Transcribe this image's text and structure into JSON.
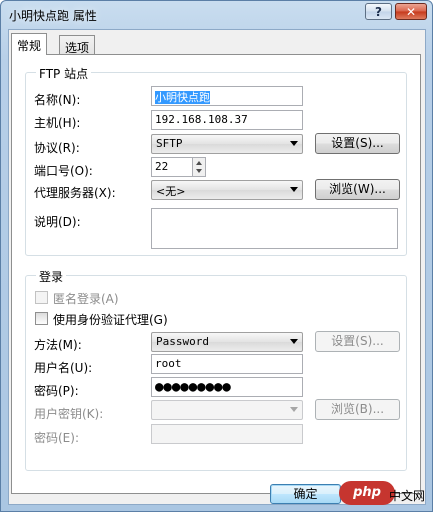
{
  "window": {
    "title": "小明快点跑 属性",
    "help_label": "?",
    "close_label": "✕"
  },
  "tabs": [
    {
      "label": "常规",
      "active": true
    },
    {
      "label": "选项",
      "active": false
    }
  ],
  "ftp_group": {
    "title": "FTP 站点",
    "name_label": "名称(N):",
    "name_value": "小明快点跑",
    "host_label": "主机(H):",
    "host_value": "192.168.108.37",
    "protocol_label": "协议(R):",
    "protocol_value": "SFTP",
    "settings_button": "设置(S)...",
    "port_label": "端口号(O):",
    "port_value": "22",
    "proxy_label": "代理服务器(X):",
    "proxy_value": "<无>",
    "browse_button": "浏览(W)...",
    "desc_label": "说明(D):"
  },
  "login_group": {
    "title": "登录",
    "anonymous_label": "匿名登录(A)",
    "use_proxy_auth_label": "使用身份验证代理(G)",
    "method_label": "方法(M):",
    "method_value": "Password",
    "settings_button": "设置(S)...",
    "username_label": "用户名(U):",
    "username_value": "root",
    "password_label": "密码(P):",
    "password_mask": "●●●●●●●●●",
    "user_key_label": "用户密钥(K):",
    "key_browse_button": "浏览(B)...",
    "passphrase_label": "密码(E):"
  },
  "footer": {
    "ok_button": "确定",
    "watermark": "php",
    "watermark_tail": "中文网"
  },
  "colors": {
    "accent": "#3399ff",
    "close": "#c5381b",
    "title_bg": "#b7cfe8"
  }
}
